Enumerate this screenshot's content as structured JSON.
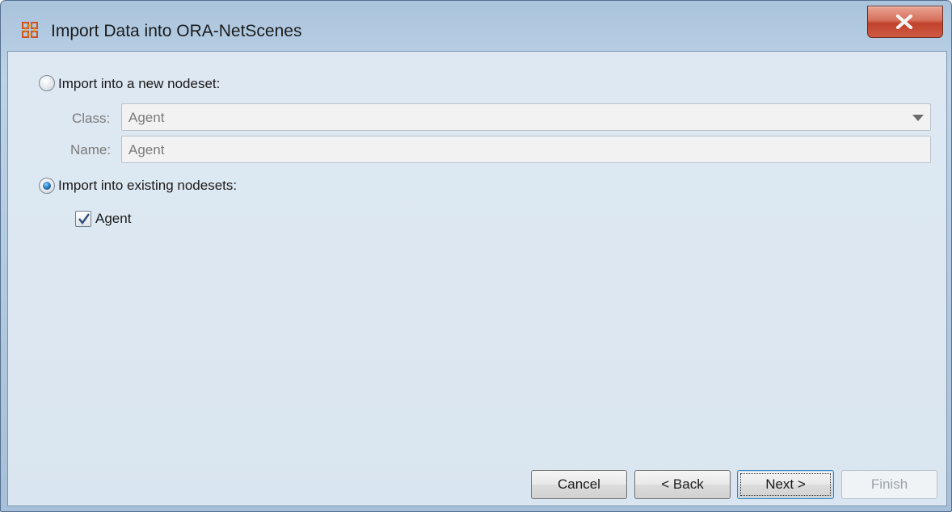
{
  "window": {
    "title": "Import Data into ORA-NetScenes",
    "close_label": "X"
  },
  "options": {
    "new_nodeset": {
      "label": "Import into a new nodeset:",
      "selected": false,
      "class_label": "Class:",
      "class_value": "Agent",
      "name_label": "Name:",
      "name_value": "Agent"
    },
    "existing_nodesets": {
      "label": "Import into existing nodesets:",
      "selected": true,
      "items": [
        {
          "label": "Agent",
          "checked": true
        }
      ]
    }
  },
  "buttons": {
    "cancel": "Cancel",
    "back": "< Back",
    "next": "Next >",
    "finish": "Finish"
  },
  "colors": {
    "title_bar": "#b6cde3",
    "client_background": "#dde8f2",
    "close_button": "#c0412b",
    "radio_selected": "#2b7fc4"
  },
  "icons": {
    "app": "ora-app-icon",
    "close": "close-icon",
    "dropdown": "chevron-down-icon",
    "check": "checkmark-icon"
  }
}
